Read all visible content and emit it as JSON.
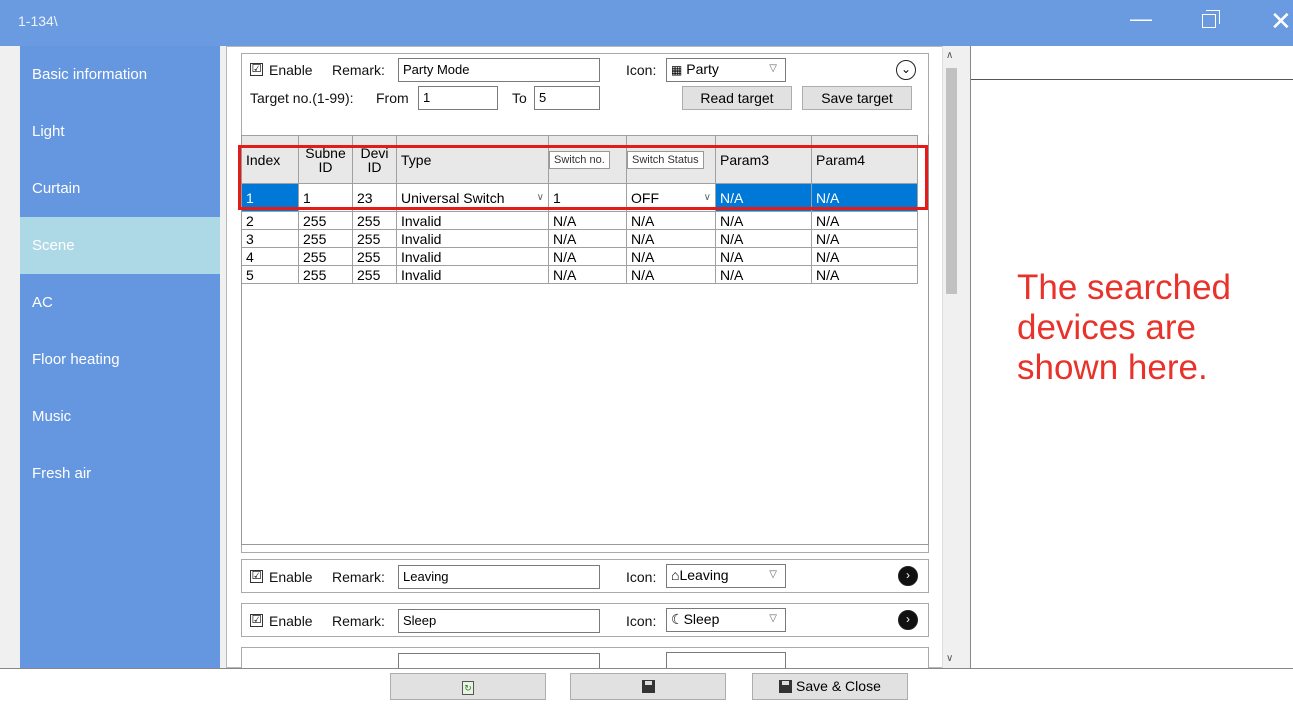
{
  "window": {
    "title": "1-134\\",
    "min_icon": "minimize-icon",
    "max_icon": "maximize-icon",
    "close_icon": "close-icon"
  },
  "sidebar": {
    "items": [
      {
        "label": "Basic information"
      },
      {
        "label": "Light"
      },
      {
        "label": "Curtain"
      },
      {
        "label": "Scene",
        "active": true
      },
      {
        "label": "AC"
      },
      {
        "label": "Floor heating"
      },
      {
        "label": "Music"
      },
      {
        "label": "Fresh air"
      }
    ],
    "color": "#6596e0",
    "active_color": "#add8e6"
  },
  "scene1": {
    "enable_label": "Enable",
    "checked": "☑",
    "remark_label": "Remark:",
    "remark_value": "Party Mode",
    "icon_label": "Icon:",
    "icon_value": "Party",
    "target_label": "Target no.(1-99):",
    "from_label": "From",
    "from_value": "1",
    "to_label": "To",
    "to_value": "5",
    "read_target": "Read target",
    "save_target": "Save target",
    "collapse_icon": "chevron-down-circle-icon"
  },
  "table": {
    "headers": {
      "index": "Index",
      "subnet_top": "Subne",
      "subnet_bottom": "ID",
      "device_top": "Devi",
      "device_bottom": "ID",
      "type": "Type",
      "switch_no_tip": "Switch no.",
      "switch_status_tip": "Switch Status",
      "param3": "Param3",
      "param4": "Param4"
    },
    "selected_row": {
      "index": "1",
      "subnet": "1",
      "device": "23",
      "type": "Universal Switch",
      "switch_no": "1",
      "status": "OFF",
      "param3": "N/A",
      "param4": "N/A"
    },
    "rows": [
      [
        "2",
        "255",
        "255",
        "Invalid",
        "N/A",
        "N/A",
        "N/A",
        "N/A"
      ],
      [
        "3",
        "255",
        "255",
        "Invalid",
        "N/A",
        "N/A",
        "N/A",
        "N/A"
      ],
      [
        "4",
        "255",
        "255",
        "Invalid",
        "N/A",
        "N/A",
        "N/A",
        "N/A"
      ],
      [
        "5",
        "255",
        "255",
        "Invalid",
        "N/A",
        "N/A",
        "N/A",
        "N/A"
      ]
    ]
  },
  "scene2": {
    "enable_label": "Enable",
    "checked": "☑",
    "remark_label": "Remark:",
    "remark_value": "Leaving",
    "icon_label": "Icon:",
    "icon_value": "Leaving"
  },
  "scene3": {
    "enable_label": "Enable",
    "checked": "☑",
    "remark_label": "Remark:",
    "remark_value": "Sleep",
    "icon_label": "Icon:",
    "icon_value": "Sleep"
  },
  "annotation": {
    "text": "The searched devices are shown here.",
    "color": "#e8322a"
  },
  "bottom": {
    "save_close": "Save & Close"
  }
}
